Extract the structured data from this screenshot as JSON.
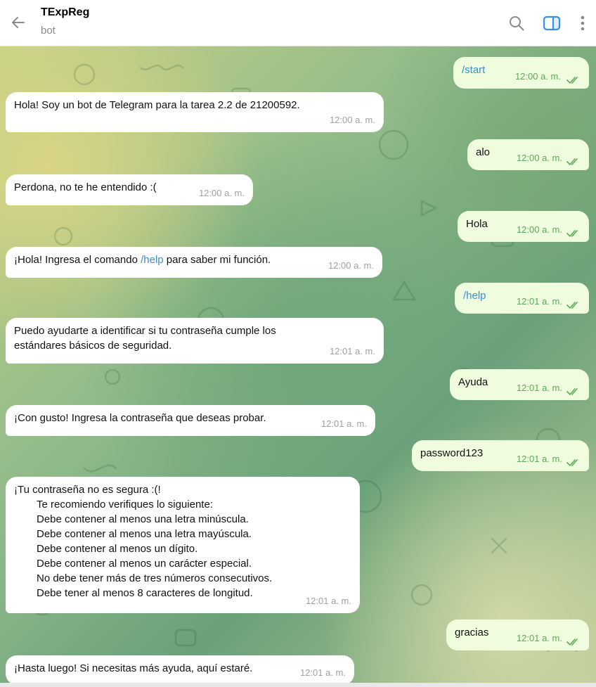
{
  "header": {
    "title": "TExpReg",
    "subtitle": "bot"
  },
  "messages": [
    {
      "dir": "out",
      "text": "/start",
      "time": "12:00 a. m.",
      "is_command": true
    },
    {
      "dir": "in",
      "text": "Hola! Soy un bot de Telegram para la tarea 2.2 de 21200592.",
      "time": "12:00 a. m."
    },
    {
      "dir": "out",
      "text": "alo",
      "time": "12:00 a. m."
    },
    {
      "dir": "in",
      "text": "Perdona, no te he entendido :(",
      "time": "12:00 a. m."
    },
    {
      "dir": "out",
      "text": "Hola",
      "time": "12:00 a. m."
    },
    {
      "dir": "in",
      "text_before": "¡Hola! Ingresa el comando ",
      "link": "/help",
      "text_after": " para saber mi función.",
      "time": "12:00 a. m."
    },
    {
      "dir": "out",
      "text": "/help",
      "time": "12:01 a. m.",
      "is_command": true
    },
    {
      "dir": "in",
      "lines": [
        "Puedo ayudarte a identificar si tu contraseña cumple los",
        "estándares básicos de seguridad."
      ],
      "time": "12:01 a. m."
    },
    {
      "dir": "out",
      "text": "Ayuda",
      "time": "12:01 a. m."
    },
    {
      "dir": "in",
      "text": "¡Con gusto! Ingresa la contraseña que deseas probar.",
      "time": "12:01 a. m."
    },
    {
      "dir": "out",
      "text": "password123",
      "time": "12:01 a. m."
    },
    {
      "dir": "in",
      "lines": [
        "¡Tu contraseña no es segura :(!",
        "Te recomiendo verifiques lo siguiente:",
        "Debe contener al menos una letra minúscula.",
        "Debe contener al menos una letra mayúscula.",
        "Debe contener al menos un dígito.",
        "Debe contener al menos un carácter especial.",
        "No debe tener más de tres números consecutivos.",
        "Debe tener al menos 8 caracteres de longitud."
      ],
      "time": "12:01 a. m."
    },
    {
      "dir": "out",
      "text": "gracias",
      "time": "12:01 a. m."
    },
    {
      "dir": "in",
      "text": "¡Hasta luego! Si necesitas más ayuda, aquí estaré.",
      "time": "12:01 a. m."
    }
  ],
  "icons": {
    "back": "arrow-left-icon",
    "search": "search-icon",
    "panel": "sidebar-toggle-icon",
    "more": "more-vertical-icon"
  },
  "colors": {
    "incoming_bubble": "#ffffff",
    "outgoing_bubble": "#effdde",
    "link": "#3a8fd0",
    "accent": "#3390ec",
    "read_ticks": "#5fa85a"
  }
}
